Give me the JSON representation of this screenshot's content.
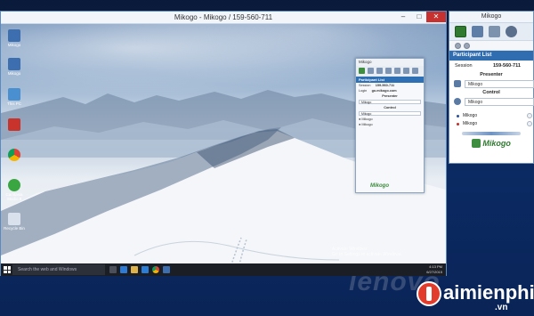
{
  "viewer": {
    "title": "Mikogo - Mikogo / 159-560-711",
    "minimize": "–",
    "maximize": "□",
    "close": "✕"
  },
  "remote_desktop": {
    "icons": [
      {
        "label": "Mikogo"
      },
      {
        "label": "Mikogo"
      },
      {
        "label": "This PC"
      },
      {
        "label": ""
      },
      {
        "label": ""
      },
      {
        "label": "Camtasia Studio 8"
      },
      {
        "label": "Recycle Bin"
      }
    ],
    "taskbar": {
      "search_placeholder": "Search the web and Windows",
      "clock_time": "4:13 PM",
      "clock_date": "6/27/2015"
    },
    "activate_line1": "Activate Windows",
    "activate_line2": "Go to Settings to activate Windows."
  },
  "mini_panel": {
    "title": "Mikogo",
    "section_title": "Participant List",
    "session_label": "Session",
    "session_value": "159-560-711",
    "login_label": "Login",
    "login_value": "go.mikogo.com",
    "presenter_heading": "Presenter",
    "presenter_value": "Mikogo",
    "control_heading": "Control",
    "control_value": "Mikogo",
    "participants": [
      "Mikogo",
      "Mikogo"
    ],
    "logo_text": "Mikogo"
  },
  "mikogo_panel": {
    "title": "Mikogo",
    "section_title": "Participant List",
    "session_label": "Session",
    "session_value": "159-560-711",
    "presenter_heading": "Presenter",
    "presenter_value": "Mikogo",
    "control_heading": "Control",
    "control_value": "Mikogo",
    "participants": [
      {
        "name": "Mikogo",
        "color": "#2b4f9a"
      },
      {
        "name": "Mikogo",
        "color": "#c0302a"
      }
    ],
    "logo_text": "Mikogo"
  },
  "watermarks": {
    "lenovo": "lenovo",
    "site_name": "aimienphi",
    "site_tld": ".vn"
  },
  "colors": {
    "section_blue": "#2f6cb0",
    "close_red": "#c7312f",
    "logo_green": "#2f7a2f"
  }
}
